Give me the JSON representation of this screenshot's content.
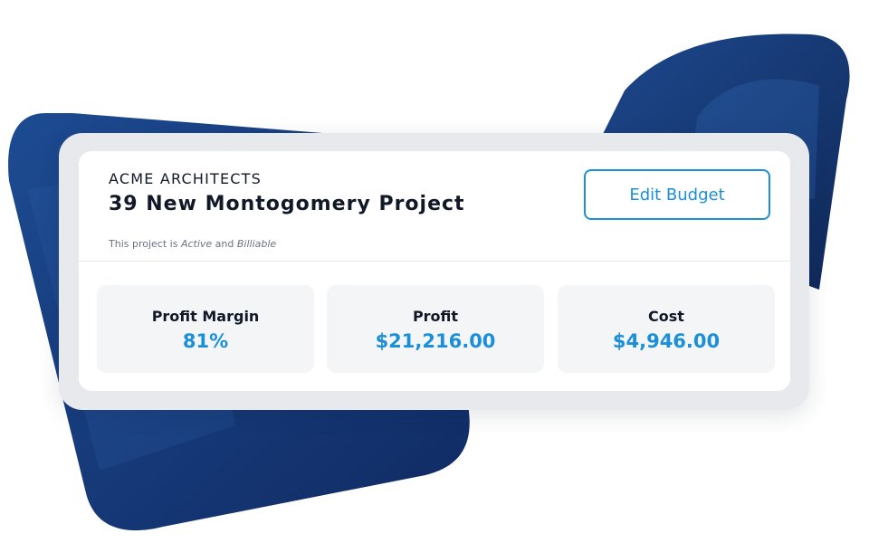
{
  "header": {
    "company": "ACME ARCHITECTS",
    "project_title": "39 New Montogomery Project",
    "status": {
      "prefix": "This project is ",
      "state": "Active",
      "connector": " and ",
      "billing": "Billiable"
    }
  },
  "actions": {
    "edit_budget_label": "Edit Budget"
  },
  "metrics": [
    {
      "label": "Profit Margin",
      "value": "81%"
    },
    {
      "label": "Profit",
      "value": "$21,216.00"
    },
    {
      "label": "Cost",
      "value": "$4,946.00"
    }
  ],
  "colors": {
    "accent": "#1b8fd8",
    "background_shapes": "#1b3c7c",
    "card_border": "#e8e9ec",
    "metric_bg": "#f4f5f6"
  }
}
